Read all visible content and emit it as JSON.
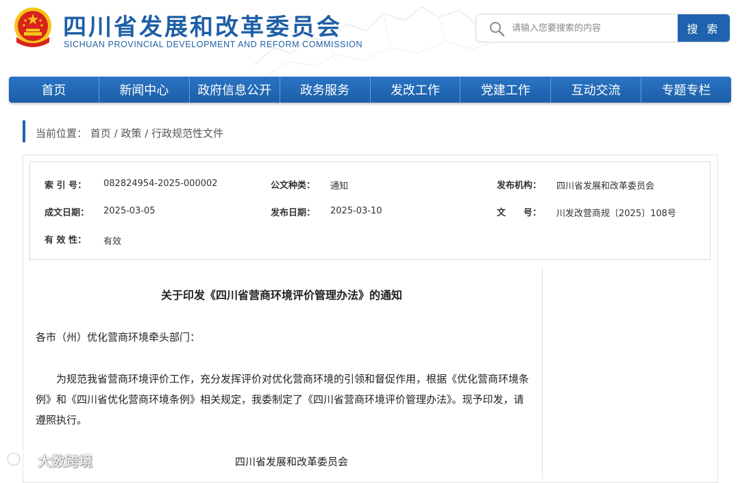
{
  "header": {
    "title_cn": "四川省发展和改革委员会",
    "title_en": "SICHUAN PROVINCIAL DEVELOPMENT AND REFORM COMMISSION"
  },
  "search": {
    "placeholder": "请输入您要搜索的内容",
    "button_label": "搜 索"
  },
  "nav": {
    "items": [
      "首页",
      "新闻中心",
      "政府信息公开",
      "政务服务",
      "发改工作",
      "党建工作",
      "互动交流",
      "专题专栏"
    ]
  },
  "breadcrumb": {
    "prefix": "当前位置：",
    "items": [
      "首页",
      "政策",
      "行政规范性文件"
    ],
    "separator": " / "
  },
  "meta": {
    "index_label": "索 引 号：",
    "index_value": "082824954-2025-000002",
    "category_label": "公文种类：",
    "category_value": "通知",
    "issuer_label": "发布机构：",
    "issuer_value": "四川省发展和改革委员会",
    "created_label": "成文日期：",
    "created_value": "2025-03-05",
    "published_label": "发布日期：",
    "published_value": "2025-03-10",
    "docno_label": "文　　号：",
    "docno_value": "川发改营商规〔2025〕108号",
    "validity_label": "有 效 性：",
    "validity_value": "有效"
  },
  "document": {
    "title": "关于印发《四川省营商环境评价管理办法》的通知",
    "salutation": "各市（州）优化营商环境牵头部门：",
    "paragraph": "为规范我省营商环境评价工作，充分发挥评价对优化营商环境的引领和督促作用，根据《优化营商环境条例》和《四川省优化营商环境条例》相关规定，我委制定了《四川省营商环境评价管理办法》。现予印发，请遵照执行。",
    "signature": "四川省发展和改革委员会"
  },
  "watermark": {
    "text": "大数跨境"
  },
  "colors": {
    "brand_blue": "#1f62ad",
    "nav_blue": "#2a74c4",
    "emblem_red": "#d9231c",
    "emblem_gold": "#f5c518"
  }
}
